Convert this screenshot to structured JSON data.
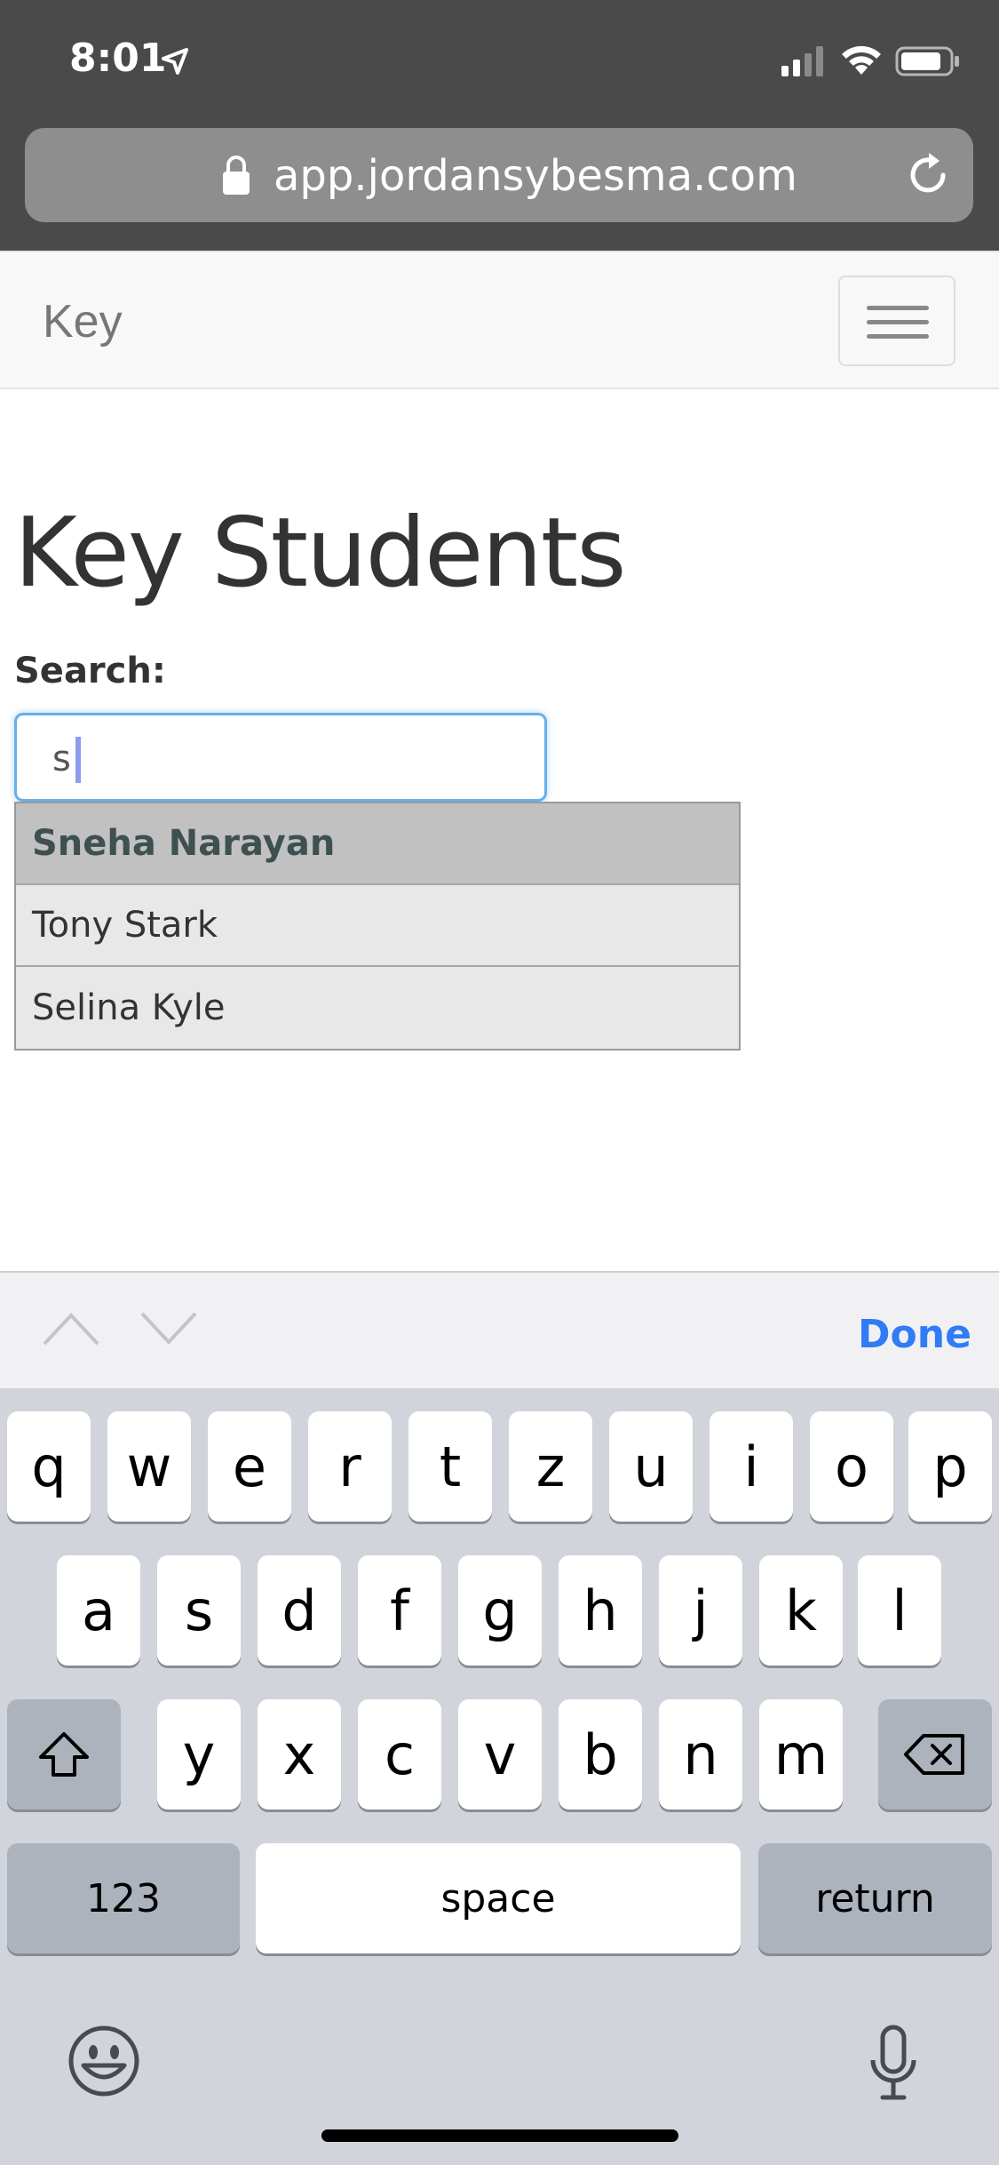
{
  "status_bar": {
    "time": "8:01"
  },
  "browser": {
    "url": "app.jordansybesma.com"
  },
  "navbar": {
    "brand": "Key"
  },
  "page": {
    "title": "Key Students",
    "search_label": "Search:",
    "search_value": "s"
  },
  "suggestions": [
    "Sneha Narayan",
    "Tony Stark",
    "Selina Kyle"
  ],
  "accessory": {
    "done_label": "Done"
  },
  "keyboard": {
    "row1": [
      "q",
      "w",
      "e",
      "r",
      "t",
      "z",
      "u",
      "i",
      "o",
      "p"
    ],
    "row2": [
      "a",
      "s",
      "d",
      "f",
      "g",
      "h",
      "j",
      "k",
      "l"
    ],
    "row3": [
      "y",
      "x",
      "c",
      "v",
      "b",
      "n",
      "m"
    ],
    "numbers_label": "123",
    "space_label": "space",
    "return_label": "return"
  },
  "colors": {
    "accent_blue": "#2f7cf6",
    "focus_border": "#66afe9",
    "chrome_bg": "#4a4a4a"
  }
}
